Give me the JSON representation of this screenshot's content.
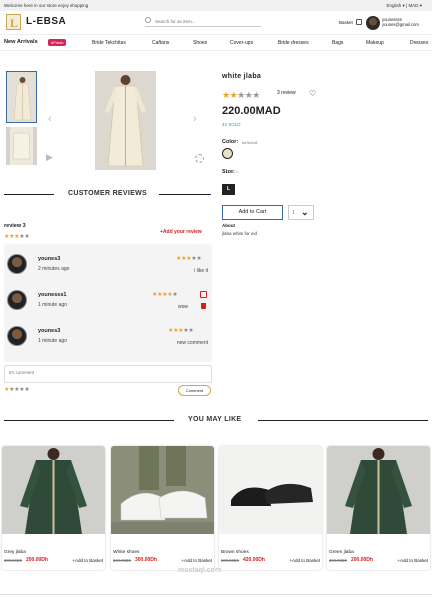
{
  "topbar": {
    "welcome": "Welcome here in our store enjoy shopping",
    "lang": "English ▾  |  MAD ▾"
  },
  "header": {
    "logo_letter": "L",
    "logo_text": "L-EBSA",
    "search_placeholder": "Search for an item...",
    "basket_label": "Basket",
    "user_name": "younessss",
    "user_email": "younes@gmail.com"
  },
  "nav": {
    "new_arrivals": "New Arrivals",
    "fresh_badge": "#Fresh",
    "items": [
      "Bride Tekchitas",
      "Caftans",
      "Shoes",
      "Cover-ups",
      "Bride dresses",
      "Bags",
      "Makeup",
      "Dresses"
    ]
  },
  "product": {
    "title": "white jlaba",
    "rating": 2,
    "rating_max": 5,
    "review_count": "3 review",
    "price": "220.00MAD",
    "stock": "42 SOLD",
    "color_label": "Color:",
    "color_code": "#e9e2c8",
    "color_swatch": "#e9e2c8",
    "size_label": "Size:",
    "size_value": "L",
    "size_option": "L",
    "add_to_cart": "Add to Cart",
    "qty_value": "1",
    "about_title": "About",
    "about_text": "jlaba white for eid"
  },
  "reviews": {
    "section_title": "CUSTOMER REVIEWS",
    "header": "review 3",
    "average_rating": 3,
    "add_review": "+Add your review",
    "items": [
      {
        "name": "younes3",
        "time": "2 minutes ago",
        "rating": 3,
        "comment": "i like it"
      },
      {
        "name": "younesss1",
        "time": "1 minute ago",
        "rating": 4,
        "comment": "wow"
      },
      {
        "name": "younes3",
        "time": "1 minute ago",
        "rating": 3,
        "comment": "new comment"
      }
    ],
    "comment_placeholder": "it's comment",
    "new_rating": 1,
    "comment_button": "Comment"
  },
  "recommendations": {
    "section_title": "YOU MAY LIKE",
    "items": [
      {
        "name": "Grey jlaba",
        "old_price": "300.00Dh",
        "price": "200.00Dh",
        "add": "+Add to Basket"
      },
      {
        "name": "White shoes",
        "old_price": "500.00Dh",
        "price": "300.00Dh",
        "add": "+Add to Basket"
      },
      {
        "name": "Brown shoes",
        "old_price": "500.00Dh",
        "price": "420.00Dh",
        "add": "+Add to Basket"
      },
      {
        "name": "Green jlaba",
        "old_price": "300.00Dh",
        "price": "200.00Dh",
        "add": "+Add to Basket"
      }
    ]
  },
  "watermark": "mostaql.com",
  "colors": {
    "accent": "#d02020",
    "star": "#f0a020",
    "fresh": "#d6245a",
    "gold": "#c9a94f"
  }
}
